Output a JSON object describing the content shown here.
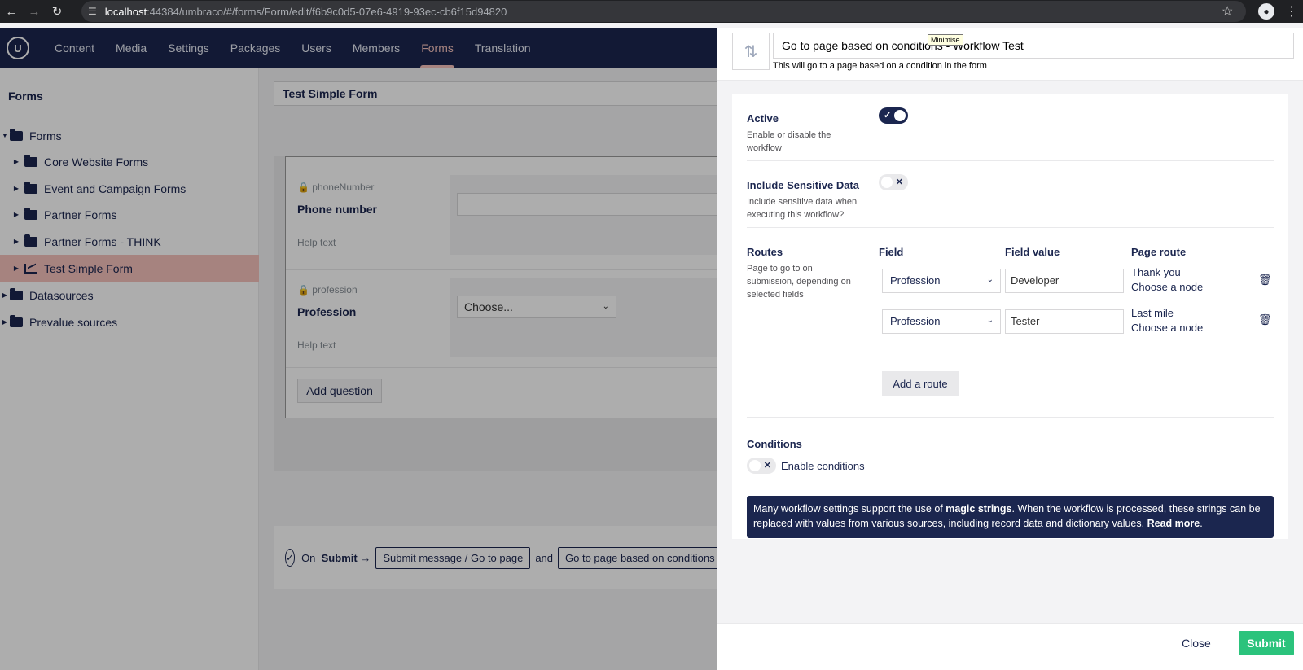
{
  "browser": {
    "url_host": "localhost",
    "url_path": ":44384/umbraco/#/forms/Form/edit/f6b9c0d5-07e6-4919-93ec-cb6f15d94820"
  },
  "nav": {
    "items": [
      "Content",
      "Media",
      "Settings",
      "Packages",
      "Users",
      "Members",
      "Forms",
      "Translation"
    ],
    "active": "Forms"
  },
  "tree": {
    "title": "Forms",
    "items": [
      {
        "label": "Forms"
      },
      {
        "label": "Core Website Forms"
      },
      {
        "label": "Event and Campaign Forms"
      },
      {
        "label": "Partner Forms"
      },
      {
        "label": "Partner Forms - THINK"
      },
      {
        "label": "Test Simple Form"
      },
      {
        "label": "Datasources"
      },
      {
        "label": "Prevalue sources"
      }
    ]
  },
  "editor": {
    "form_name": "Test Simple Form",
    "questions": [
      {
        "alias": "phoneNumber",
        "label": "Phone number",
        "help": "Help text"
      },
      {
        "alias": "profession",
        "label": "Profession",
        "help": "Help text",
        "select_value": "Choose..."
      }
    ],
    "add_question": "Add question",
    "workflow": {
      "on": "On",
      "event": "Submit",
      "arrow": "→",
      "first": "Submit message / Go to page",
      "and": "and",
      "second": "Go to page based on conditions - Wo"
    }
  },
  "panel": {
    "name": "Go to page based on conditions - Workflow Test",
    "description": "This will go to a page based on a condition in the form",
    "tooltip": "Minimise",
    "active": {
      "label": "Active",
      "desc": "Enable or disable the workflow",
      "value": true
    },
    "sensitive": {
      "label": "Include Sensitive Data",
      "desc": "Include sensitive data when executing this workflow?",
      "value": false
    },
    "routes": {
      "label": "Routes",
      "desc": "Page to go to on submission, depending on selected fields",
      "columns": [
        "Field",
        "Field value",
        "Page route"
      ],
      "rows": [
        {
          "field": "Profession",
          "value": "Developer",
          "page": "Thank you",
          "node": "Choose a node"
        },
        {
          "field": "Profession",
          "value": "Tester",
          "page": "Last mile",
          "node": "Choose a node"
        }
      ],
      "add_route": "Add a route"
    },
    "conditions": {
      "label": "Conditions",
      "toggle_label": "Enable conditions",
      "value": false
    },
    "info": {
      "part1": "Many workflow settings support the use of ",
      "bold": "magic strings",
      "part2": ". When the workflow is processed, these strings can be replaced with values from various sources, including record data and dictionary values. ",
      "link": "Read more",
      "end": "."
    },
    "footer": {
      "close": "Close",
      "submit": "Submit"
    }
  },
  "colors": {
    "navy": "#1b264f",
    "accent_pink": "#f5c1bc",
    "submit_green": "#2bc37c"
  }
}
